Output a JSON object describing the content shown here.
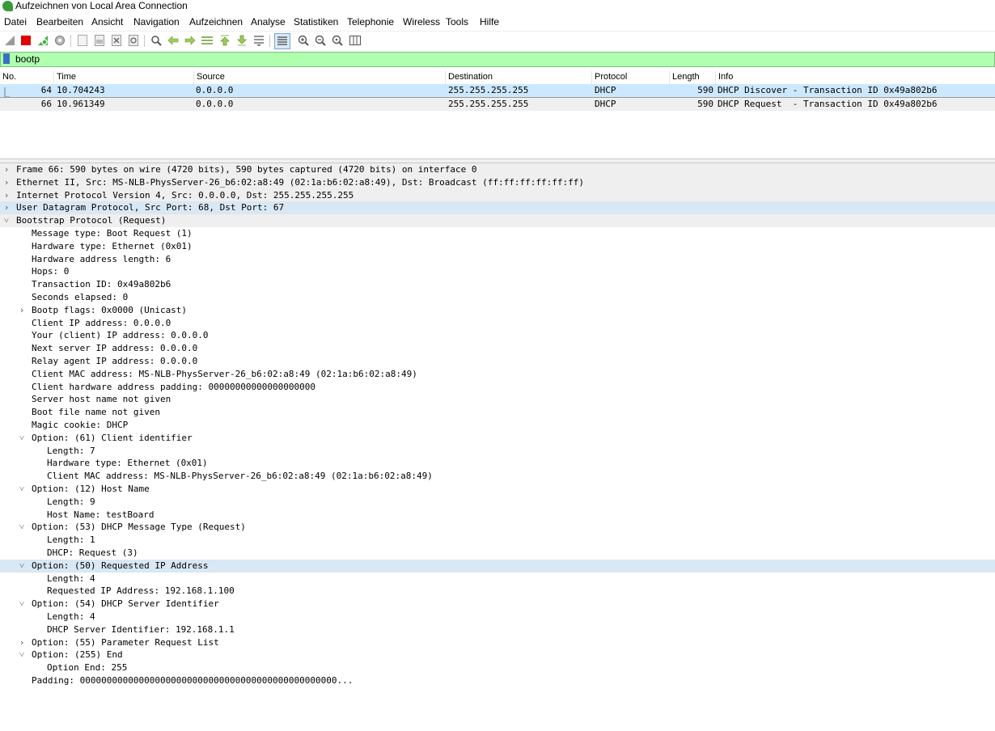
{
  "window": {
    "title": "Aufzeichnen von Local Area Connection"
  },
  "menu": [
    "Datei",
    "Bearbeiten",
    "Ansicht",
    "Navigation",
    "Aufzeichnen",
    "Analyse",
    "Statistiken",
    "Telephonie",
    "Wireless",
    "Tools",
    "Hilfe"
  ],
  "toolbar_icons": [
    "shark-fin-start-icon",
    "stop-square-icon",
    "restart-icon",
    "options-gear-icon",
    "open-file-icon",
    "save-file-icon",
    "close-file-icon",
    "reload-file-icon",
    "find-packet-icon",
    "go-back-icon",
    "go-forward-icon",
    "go-to-packet-icon",
    "first-packet-icon",
    "last-packet-icon",
    "auto-scroll-icon",
    "colorize-icon",
    "zoom-in-icon",
    "zoom-out-icon",
    "zoom-normal-icon",
    "resize-columns-icon"
  ],
  "filter": {
    "value": "bootp"
  },
  "packet_list": {
    "columns": [
      "No.",
      "Time",
      "Source",
      "Destination",
      "Protocol",
      "Length",
      "Info"
    ],
    "rows": [
      {
        "no": "64",
        "time": "10.704243",
        "source": "0.0.0.0",
        "destination": "255.255.255.255",
        "protocol": "DHCP",
        "length": "590",
        "info": "DHCP Discover - Transaction ID 0x49a802b6"
      },
      {
        "no": "66",
        "time": "10.961349",
        "source": "0.0.0.0",
        "destination": "255.255.255.255",
        "protocol": "DHCP",
        "length": "590",
        "info": "DHCP Request  - Transaction ID 0x49a802b6"
      }
    ]
  },
  "details": [
    {
      "text": "Frame 66: 590 bytes on wire (4720 bits), 590 bytes captured (4720 bits) on interface 0",
      "level": 0,
      "arrow": "collapsed",
      "bg": "gray"
    },
    {
      "text": "Ethernet II, Src: MS-NLB-PhysServer-26_b6:02:a8:49 (02:1a:b6:02:a8:49), Dst: Broadcast (ff:ff:ff:ff:ff:ff)",
      "level": 0,
      "arrow": "collapsed",
      "bg": "gray"
    },
    {
      "text": "Internet Protocol Version 4, Src: 0.0.0.0, Dst: 255.255.255.255",
      "level": 0,
      "arrow": "collapsed",
      "bg": "gray"
    },
    {
      "text": "User Datagram Protocol, Src Port: 68, Dst Port: 67",
      "level": 0,
      "arrow": "collapsed",
      "bg": "blue"
    },
    {
      "text": "Bootstrap Protocol (Request)",
      "level": 0,
      "arrow": "expanded",
      "bg": "gray"
    },
    {
      "text": "Message type: Boot Request (1)",
      "level": 1,
      "arrow": "none"
    },
    {
      "text": "Hardware type: Ethernet (0x01)",
      "level": 1,
      "arrow": "none"
    },
    {
      "text": "Hardware address length: 6",
      "level": 1,
      "arrow": "none"
    },
    {
      "text": "Hops: 0",
      "level": 1,
      "arrow": "none"
    },
    {
      "text": "Transaction ID: 0x49a802b6",
      "level": 1,
      "arrow": "none"
    },
    {
      "text": "Seconds elapsed: 0",
      "level": 1,
      "arrow": "none"
    },
    {
      "text": "Bootp flags: 0x0000 (Unicast)",
      "level": 1,
      "arrow": "collapsed"
    },
    {
      "text": "Client IP address: 0.0.0.0",
      "level": 1,
      "arrow": "none"
    },
    {
      "text": "Your (client) IP address: 0.0.0.0",
      "level": 1,
      "arrow": "none"
    },
    {
      "text": "Next server IP address: 0.0.0.0",
      "level": 1,
      "arrow": "none"
    },
    {
      "text": "Relay agent IP address: 0.0.0.0",
      "level": 1,
      "arrow": "none"
    },
    {
      "text": "Client MAC address: MS-NLB-PhysServer-26_b6:02:a8:49 (02:1a:b6:02:a8:49)",
      "level": 1,
      "arrow": "none"
    },
    {
      "text": "Client hardware address padding: 00000000000000000000",
      "level": 1,
      "arrow": "none"
    },
    {
      "text": "Server host name not given",
      "level": 1,
      "arrow": "none"
    },
    {
      "text": "Boot file name not given",
      "level": 1,
      "arrow": "none"
    },
    {
      "text": "Magic cookie: DHCP",
      "level": 1,
      "arrow": "none"
    },
    {
      "text": "Option: (61) Client identifier",
      "level": 1,
      "arrow": "expanded"
    },
    {
      "text": "Length: 7",
      "level": 2,
      "arrow": "none"
    },
    {
      "text": "Hardware type: Ethernet (0x01)",
      "level": 2,
      "arrow": "none"
    },
    {
      "text": "Client MAC address: MS-NLB-PhysServer-26_b6:02:a8:49 (02:1a:b6:02:a8:49)",
      "level": 2,
      "arrow": "none"
    },
    {
      "text": "Option: (12) Host Name",
      "level": 1,
      "arrow": "expanded"
    },
    {
      "text": "Length: 9",
      "level": 2,
      "arrow": "none"
    },
    {
      "text": "Host Name: testBoard",
      "level": 2,
      "arrow": "none"
    },
    {
      "text": "Option: (53) DHCP Message Type (Request)",
      "level": 1,
      "arrow": "expanded"
    },
    {
      "text": "Length: 1",
      "level": 2,
      "arrow": "none"
    },
    {
      "text": "DHCP: Request (3)",
      "level": 2,
      "arrow": "none"
    },
    {
      "text": "Option: (50) Requested IP Address",
      "level": 1,
      "arrow": "expanded",
      "bg": "blue"
    },
    {
      "text": "Length: 4",
      "level": 2,
      "arrow": "none"
    },
    {
      "text": "Requested IP Address: 192.168.1.100",
      "level": 2,
      "arrow": "none"
    },
    {
      "text": "Option: (54) DHCP Server Identifier",
      "level": 1,
      "arrow": "expanded"
    },
    {
      "text": "Length: 4",
      "level": 2,
      "arrow": "none"
    },
    {
      "text": "DHCP Server Identifier: 192.168.1.1",
      "level": 2,
      "arrow": "none"
    },
    {
      "text": "Option: (55) Parameter Request List",
      "level": 1,
      "arrow": "collapsed"
    },
    {
      "text": "Option: (255) End",
      "level": 1,
      "arrow": "expanded"
    },
    {
      "text": "Option End: 255",
      "level": 2,
      "arrow": "none"
    },
    {
      "text": "Padding: 000000000000000000000000000000000000000000000000...",
      "level": 1,
      "arrow": "none"
    }
  ],
  "colors": {
    "filter_bg": "#afffaf",
    "selected_row": "#cce8ff",
    "header_row_bg": "#efefef",
    "highlight_blue": "#d8e8f4"
  }
}
